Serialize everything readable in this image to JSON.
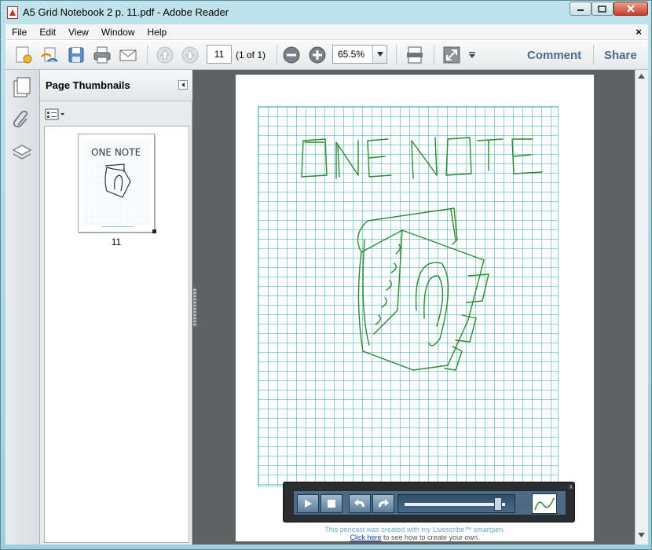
{
  "window": {
    "title": "A5 Grid Notebook 2 p. 11.pdf - Adobe Reader"
  },
  "menu": {
    "items": [
      "File",
      "Edit",
      "View",
      "Window",
      "Help"
    ],
    "close_glyph": "×"
  },
  "toolbar": {
    "page_number": "11",
    "page_of": "(1 of 1)",
    "zoom": "65.5%",
    "comment_label": "Comment",
    "share_label": "Share"
  },
  "nav_pane": {
    "title": "Page Thumbnails",
    "thumbnail_label": "11"
  },
  "document": {
    "handwriting_text": "ONE NOTE",
    "grid_color": "#3caabe",
    "ink_color": "#2a8a2a"
  },
  "player": {
    "close_glyph": "x",
    "progress": 0.93
  },
  "credits": {
    "line1": "This pencast was created with my Livescribe™ smartpen.",
    "link_text": "Click here",
    "line2_rest": " to see how to create your own."
  }
}
